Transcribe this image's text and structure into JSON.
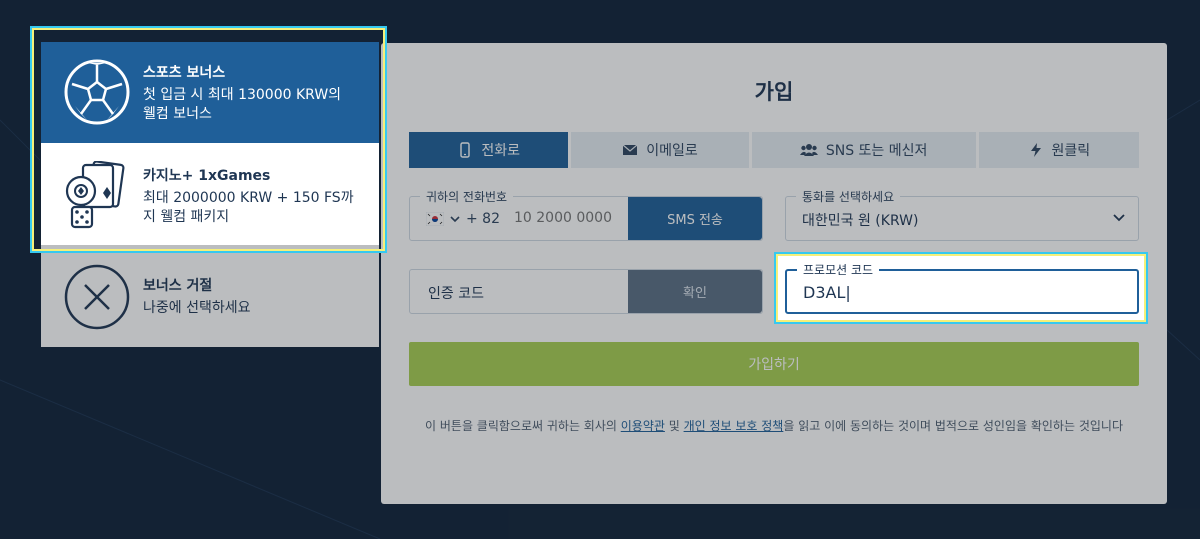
{
  "registration": {
    "title": "가입",
    "tabs": [
      {
        "label": "전화로",
        "icon": "phone-icon",
        "active": true
      },
      {
        "label": "이메일로",
        "icon": "envelope-icon",
        "active": false
      },
      {
        "label": "SNS 또는 메신저",
        "icon": "users-icon",
        "active": false
      },
      {
        "label": "원클릭",
        "icon": "lightning-icon",
        "active": false
      }
    ],
    "phone": {
      "legend": "귀하의 전화번호",
      "country_flag": "korea-flag-icon",
      "country_code": "+ 82",
      "placeholder": "10 2000 0000",
      "sms_button": "SMS 전송"
    },
    "currency": {
      "legend": "통화를 선택하세요",
      "selected": "대한민국 원 (KRW)"
    },
    "verification": {
      "label": "인증 코드",
      "confirm_button": "확인"
    },
    "promo": {
      "legend": "프로모션 코드",
      "value": "D3AL|"
    },
    "register_button": "가입하기",
    "terms": {
      "prefix": "이 버튼을 클릭함으로써 귀하는 회사의 ",
      "link1": "이용약관",
      "middle": " 및 ",
      "link2": "개인 정보 보호 정책",
      "suffix": "을 읽고 이에 동의하는 것이며 법적으로 성인임을 확인하는 것입니다"
    }
  },
  "bonus_panel": {
    "items": [
      {
        "title": "스포츠 보너스",
        "description": "첫 입금 시 최대 130000 KRW의 웰컴 보너스",
        "icon": "soccer-ball-icon",
        "selected": true
      },
      {
        "title": "카지노+ 1xGames",
        "description": "최대 2000000 KRW + 150 FS까지 웰컴 패키지",
        "icon": "casino-cards-dice-icon",
        "selected": false
      },
      {
        "title": "보너스 거절",
        "description": "나중에 선택하세요",
        "icon": "close-circle-icon",
        "selected": false
      }
    ]
  },
  "colors": {
    "background": "#0f2238",
    "primary": "#1f5f99",
    "register_button": "#a8cf52",
    "highlight_yellow": "#f5f07a",
    "highlight_cyan": "#36c9f0"
  }
}
